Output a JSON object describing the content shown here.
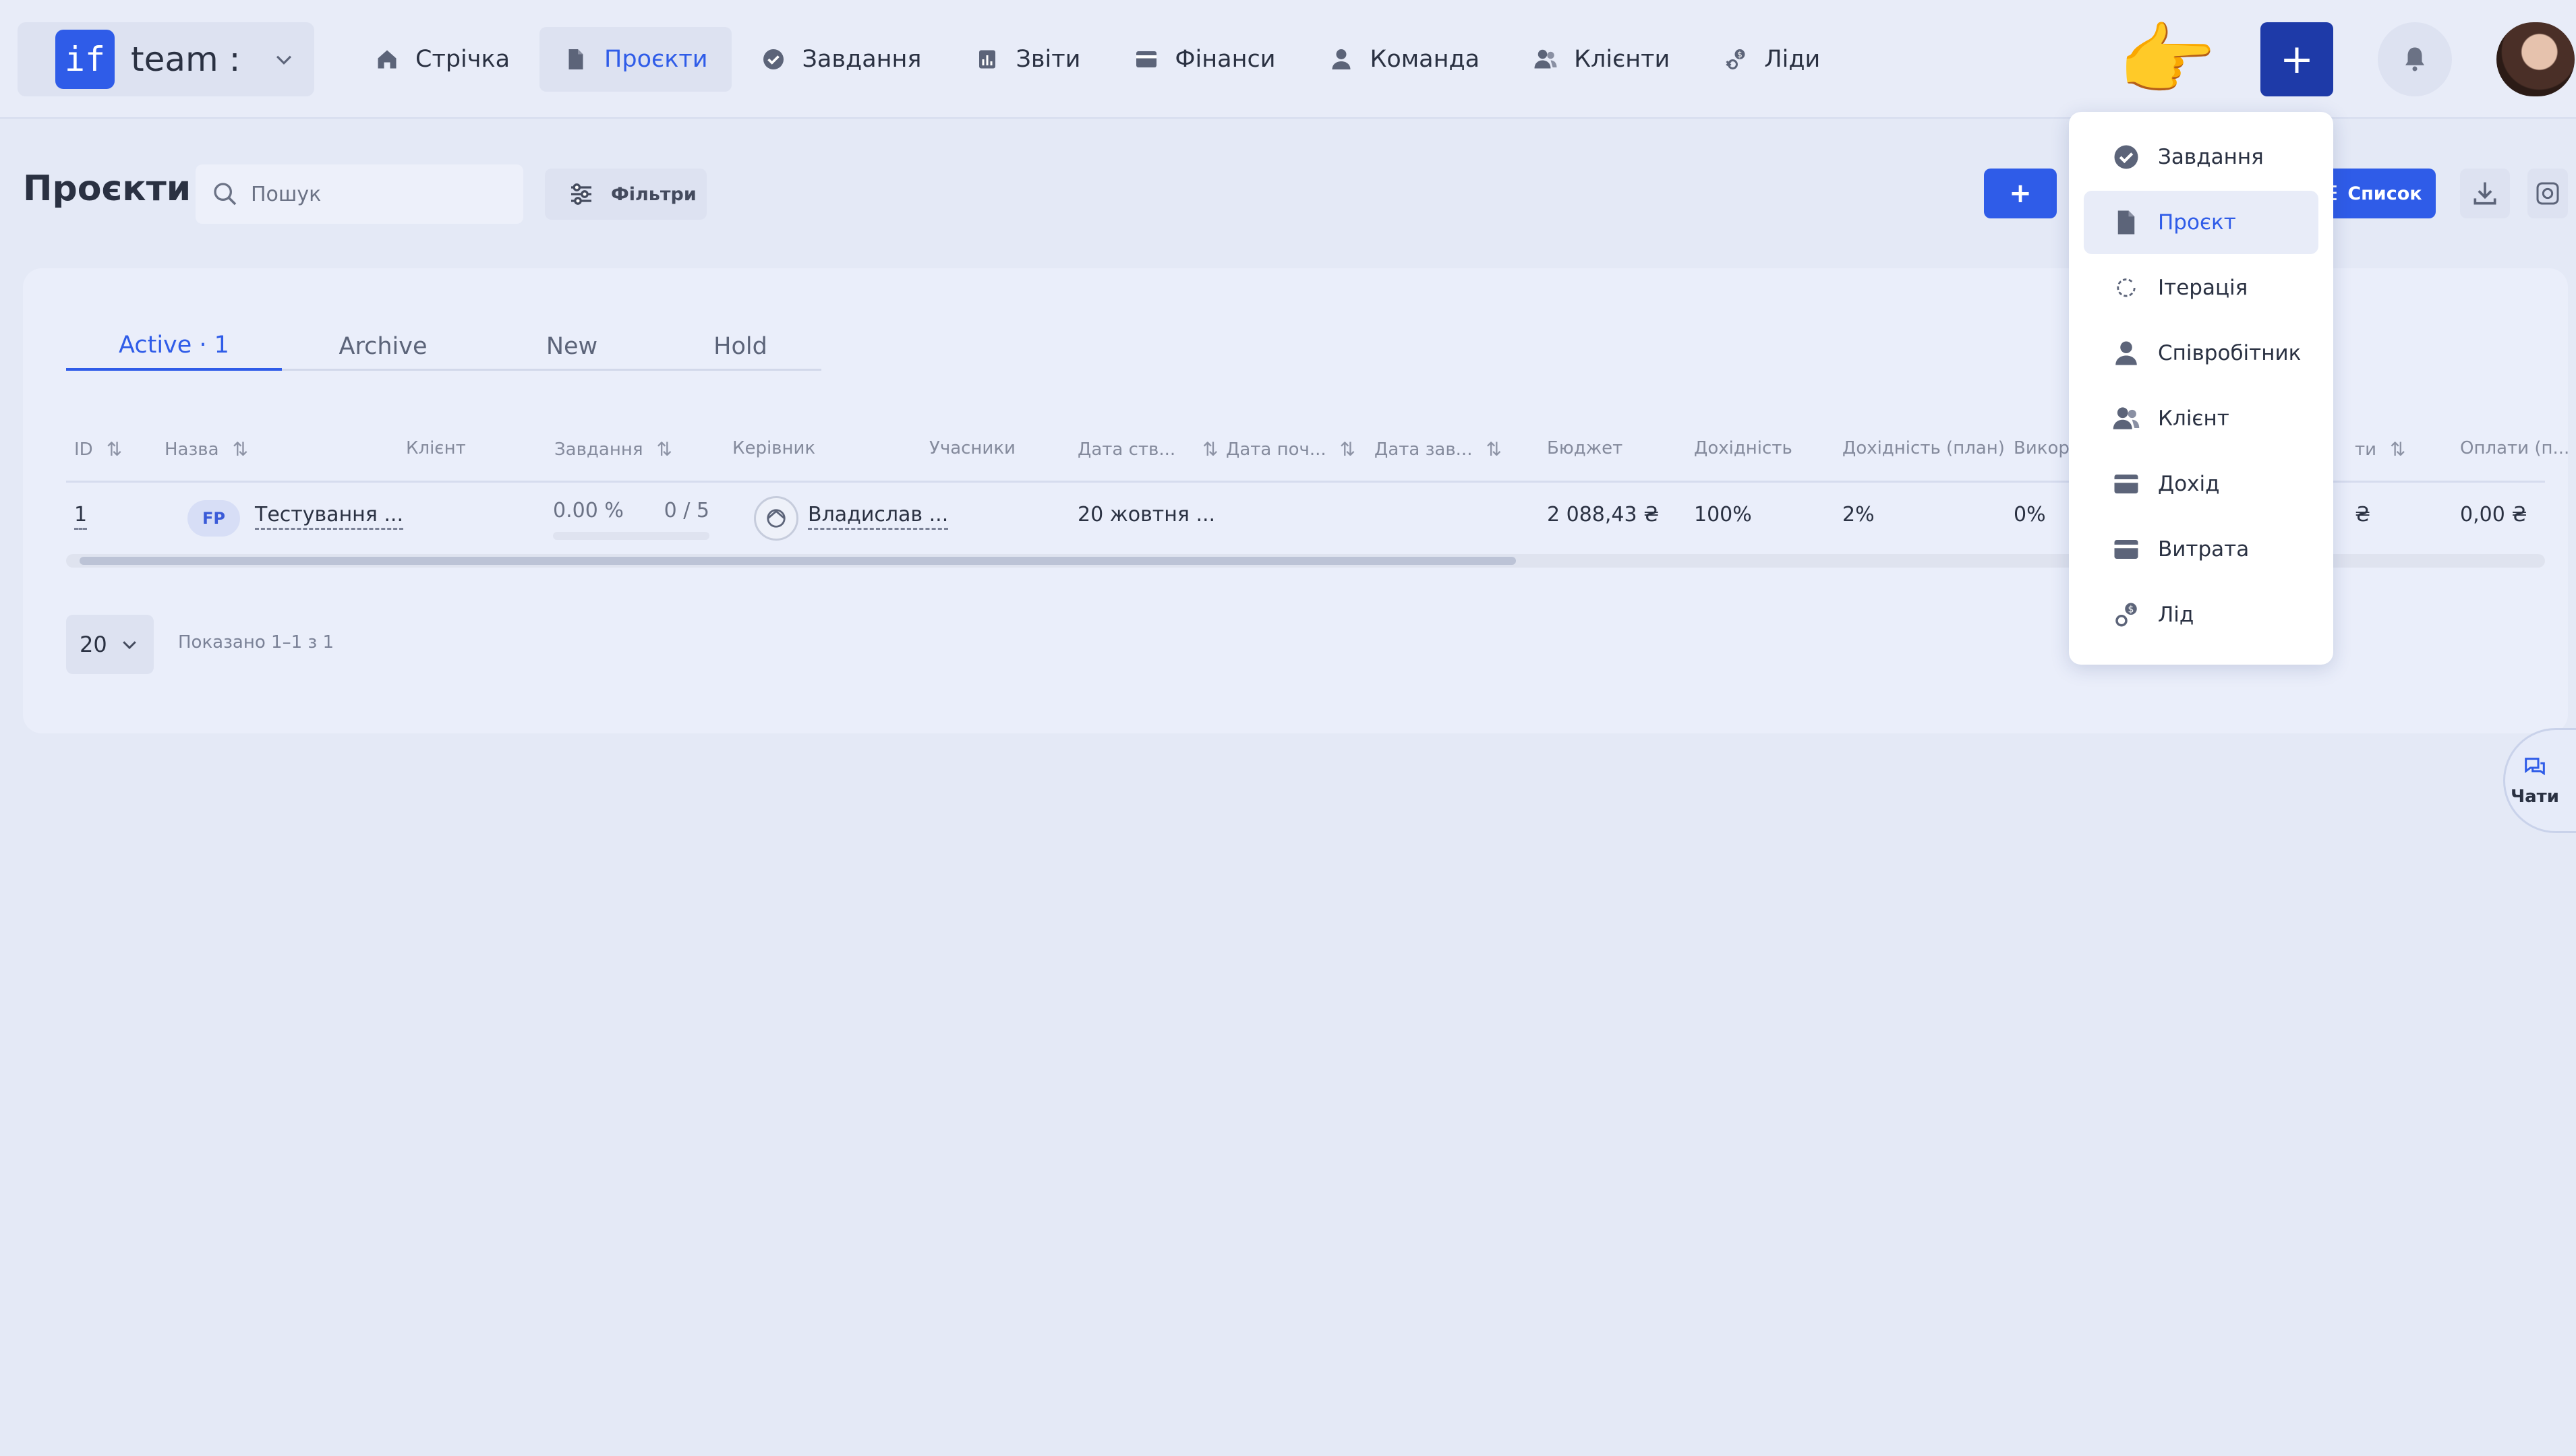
{
  "team": {
    "logo_text": "if",
    "name": "team :"
  },
  "nav": [
    {
      "label": "Стрічка",
      "icon": "home-icon"
    },
    {
      "label": "Проєкти",
      "icon": "document-icon",
      "active": true
    },
    {
      "label": "Завдання",
      "icon": "check-circle-icon"
    },
    {
      "label": "Звіти",
      "icon": "chart-icon"
    },
    {
      "label": "Фінанси",
      "icon": "wallet-icon"
    },
    {
      "label": "Команда",
      "icon": "person-icon"
    },
    {
      "label": "Клієнти",
      "icon": "people-icon"
    },
    {
      "label": "Ліди",
      "icon": "lead-icon"
    }
  ],
  "header": {
    "hand_emoji": "👉",
    "add_label": "+",
    "bell_icon": "bell-icon"
  },
  "page": {
    "title": "Проєкти",
    "search_placeholder": "Пошук",
    "filters_label": "Фільтри",
    "add_label": "+",
    "list_label": "Список"
  },
  "tabs": [
    {
      "label": "Active · 1",
      "active": true
    },
    {
      "label": "Archive"
    },
    {
      "label": "New"
    },
    {
      "label": "Hold"
    }
  ],
  "table": {
    "columns": [
      "ID",
      "Назва",
      "Клієнт",
      "Завдання",
      "Керівник",
      "Учасники",
      "Дата ств...",
      "Дата поч...",
      "Дата зав...",
      "Бюджет",
      "Дохідність",
      "Дохідність (план)",
      "Використ",
      "ти",
      "Оплати (п..."
    ],
    "row": {
      "id": "1",
      "badge": "FP",
      "name": "Тестування ...",
      "tasks_percent": "0.00 %",
      "tasks_percent_value": 0,
      "tasks_count": "0 / 5",
      "manager": "Владислав ...",
      "created": "20 жовтня ...",
      "budget": "2 088,43 ₴",
      "profitability": "100%",
      "profitability_plan": "2%",
      "used": "0%",
      "col_ti": "₴",
      "payments": "0,00 ₴"
    }
  },
  "pagination": {
    "per_page": "20",
    "shown": "Показано 1–1 з 1"
  },
  "dropdown": [
    {
      "label": "Завдання",
      "icon": "check-circle-icon"
    },
    {
      "label": "Проєкт",
      "icon": "document-icon",
      "active": true
    },
    {
      "label": "Ітерація",
      "icon": "refresh-icon"
    },
    {
      "label": "Співробітник",
      "icon": "person-icon"
    },
    {
      "label": "Клієнт",
      "icon": "people-icon"
    },
    {
      "label": "Дохід",
      "icon": "card-icon"
    },
    {
      "label": "Витрата",
      "icon": "card-icon"
    },
    {
      "label": "Лід",
      "icon": "lead-icon"
    }
  ],
  "chats": {
    "label": "Чати"
  },
  "colors": {
    "accent": "#2f5ce8",
    "accent_dark": "#1e3aa8",
    "background": "#e4e9f6"
  }
}
